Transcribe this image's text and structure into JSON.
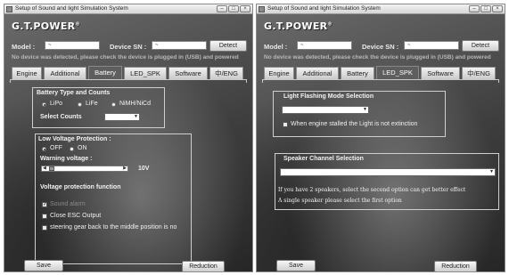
{
  "window": {
    "title": "Setup of Sound and light Simulation System",
    "controls": {
      "minimize": "–",
      "maximize": "□",
      "close": "×"
    }
  },
  "brand": "G.T.POWER",
  "brand_mark": "®",
  "model_label": "Model :",
  "model_value": "~",
  "device_sn_label": "Device SN :",
  "device_sn_value": "~",
  "detect_button": "Detect",
  "notice": "No device was detected, please check the device is plugged in (USB) and powered",
  "tabs": [
    "Engine",
    "Additional",
    "Battery",
    "LED_SPK",
    "Software",
    "中/ENG"
  ],
  "save_button": "Save",
  "reduction_button": "Reduction",
  "battery": {
    "active_tab": "Battery",
    "battery_group_title": "Battery Type and Counts",
    "types": [
      "LiPo",
      "LiFe",
      "NiMH/NiCd"
    ],
    "selected_type": "LiPo",
    "select_counts_label": "Select Counts",
    "select_counts_value": "",
    "low_voltage_title": "Low Voltage Protection :",
    "lv_options": [
      "OFF",
      "ON"
    ],
    "lv_selected": "OFF",
    "warning_voltage_label": "Warning voltage :",
    "warning_voltage_value": "10V",
    "warning_voltage_level": 0.08,
    "function_title": "Voltage protection function",
    "functions": [
      {
        "label": "Sound alarm",
        "checked": true
      },
      {
        "label": "Close ESC Output",
        "checked": false
      },
      {
        "label": "steering gear back to the middle position is no",
        "checked": false
      }
    ]
  },
  "led_spk": {
    "active_tab": "LED_SPK",
    "light_group_title": "Light Flashing Mode Selection",
    "light_mode_value": "",
    "engine_stalled_label": "When engine stalled the Light is not extinction",
    "engine_stalled_checked": false,
    "speaker_group_title": "Speaker Channel Selection",
    "speaker_value": "",
    "note_line_1": "If you have 2 speakers, select the second option can get better effect",
    "note_line_2": "A single speaker please select the first option"
  },
  "icons": {
    "app": "app-icon",
    "radio": "radio-icon",
    "checkbox": "checkbox-icon",
    "dropdown": "chevron-down-icon",
    "slider_left": "arrow-left-icon",
    "slider_right": "arrow-right-icon"
  },
  "colors": {
    "background": "#4a4a4a",
    "titlebar": "#e4e4e4",
    "text": "#ffffff",
    "active_tab": "#5e5e5e"
  }
}
